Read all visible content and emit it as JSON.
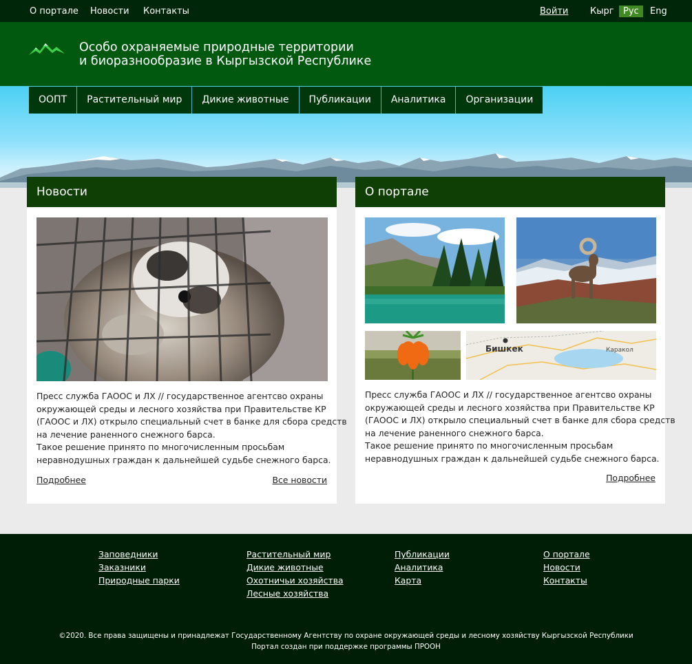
{
  "topbar": {
    "links": [
      "О портале",
      "Новости",
      "Контакты"
    ],
    "login": "Войти",
    "languages": [
      "Кырг",
      "Рус",
      "Eng"
    ],
    "active_language": "Рус"
  },
  "header": {
    "title_line1": "Особо охраняемые природные территории",
    "title_line2": "и биоразнообразие в Кыргызской Республике",
    "logo_icon": "mountains-logo-icon"
  },
  "nav": [
    "ООПТ",
    "Растительный мир",
    "Дикие животные",
    "Публикации",
    "Аналитика",
    "Организации"
  ],
  "news": {
    "heading": "Новости",
    "paragraph1": [
      "Пресс служба ГАООС и ЛХ // государственное агентсво охраны",
      "окружающей среды и лесного хозяйства при Правительстве КР",
      "(ГАООС и ЛХ) открыло специальный счет в банке для сбора средств",
      "на лечение раненного снежного барса."
    ],
    "paragraph2": [
      "Такое решение принято по многочисленным просьбам",
      "неравнодушных граждан к дальнейшей судьбе снежного барса."
    ],
    "more_link": "Подробнее",
    "all_news_link": "Все новости"
  },
  "about": {
    "heading": "О портале",
    "map_labels": {
      "city": "Бишкек",
      "town": "Каракол"
    },
    "paragraph1": [
      "Пресс служба ГАООС и ЛХ // государственное агентсво охраны",
      "окружающей среды и лесного хозяйства при Правительстве КР",
      "(ГАООС и ЛХ) открыло специальный счет в банке для сбора средств",
      "на лечение раненного снежного барса."
    ],
    "paragraph2": [
      "Такое решение принято по многочисленным просьбам",
      "неравнодушных граждан к дальнейшей судьбе снежного барса."
    ],
    "more_link": "Подробнее"
  },
  "footer": {
    "col1": [
      "Заповедники",
      "Заказники",
      "Природные парки"
    ],
    "col2": [
      "Растительный мир",
      "Дикие животные",
      "Охотничьи хозяйства",
      "Лесные хозяйства"
    ],
    "col3": [
      "Публикации",
      "Аналитика",
      "Карта"
    ],
    "col4": [
      "О портале",
      "Новости",
      "Контакты"
    ],
    "copyright": "©2020. Все права защищены и принадлежат Государственному Агентству по охране окружающей среды и лесному хозяйству Кыргызской Республики",
    "credit": "Портал создан при поддержке программы ПРООН"
  }
}
